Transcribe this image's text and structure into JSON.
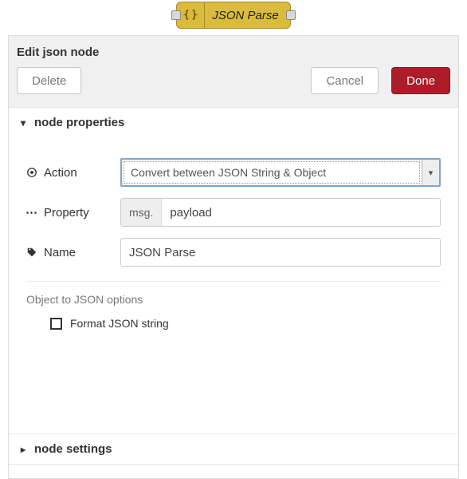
{
  "node": {
    "label": "JSON Parse",
    "icon_name": "braces-icon"
  },
  "panel": {
    "title": "Edit json node",
    "buttons": {
      "delete": "Delete",
      "cancel": "Cancel",
      "done": "Done"
    }
  },
  "sections": {
    "properties": {
      "title": "node properties",
      "expanded": true
    },
    "settings": {
      "title": "node settings",
      "expanded": false
    }
  },
  "form": {
    "action": {
      "label": "Action",
      "value": "Convert between JSON String & Object"
    },
    "property": {
      "label": "Property",
      "prefix": "msg.",
      "value": "payload"
    },
    "name": {
      "label": "Name",
      "value": "JSON Parse"
    },
    "options_title": "Object to JSON options",
    "format_checkbox": {
      "label": "Format JSON string",
      "checked": false
    }
  }
}
